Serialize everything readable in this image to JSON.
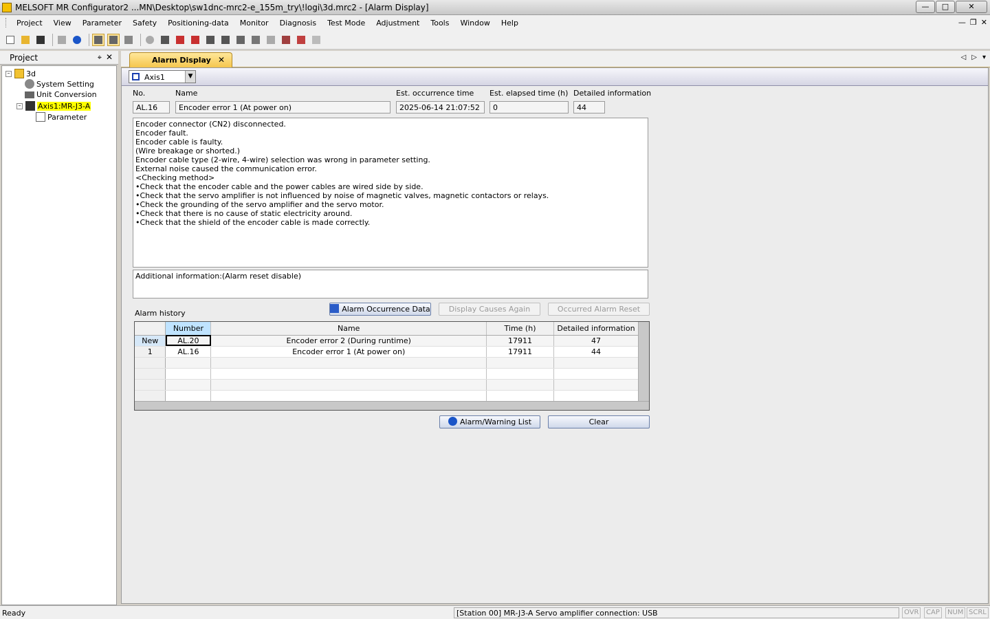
{
  "window": {
    "title": "MELSOFT MR Configurator2 ...MN\\Desktop\\sw1dnc-mrc2-e_155m_try\\!logi\\3d.mrc2 - [Alarm Display]"
  },
  "menu": [
    "Project",
    "View",
    "Parameter",
    "Safety",
    "Positioning-data",
    "Monitor",
    "Diagnosis",
    "Test Mode",
    "Adjustment",
    "Tools",
    "Window",
    "Help"
  ],
  "project_pane": {
    "title": "Project",
    "tree": {
      "root": "3d",
      "system_setting": "System Setting",
      "unit_conversion": "Unit Conversion",
      "axis": "Axis1:MR-J3-A",
      "parameter": "Parameter"
    }
  },
  "tab": {
    "label": "Alarm Display"
  },
  "axis_select": {
    "value": "Axis1"
  },
  "alarm": {
    "labels": {
      "no": "No.",
      "name": "Name",
      "occurrence": "Est. occurrence time",
      "elapsed": "Est. elapsed time (h)",
      "detail": "Detailed information"
    },
    "no": "AL.16",
    "name": "Encoder error 1 (At power on)",
    "occurrence": "2025-06-14 21:07:52",
    "elapsed": "0",
    "detail": "44",
    "description": [
      "Encoder connector (CN2) disconnected.",
      "",
      "Encoder fault.",
      "",
      "Encoder cable is faulty.",
      "(Wire breakage or shorted.)",
      "",
      "Encoder cable type (2-wire, 4-wire) selection was wrong in parameter setting.",
      "",
      "External noise caused the communication error.",
      "<Checking method>",
      "•Check that the encoder cable and the power cables are wired side by side.",
      "•Check that the servo amplifier is not influenced by noise of magnetic valves, magnetic contactors or relays.",
      "•Check the grounding of the servo amplifier and the servo motor.",
      "•Check that there is no cause of static electricity around.",
      "•Check that the shield of the encoder cable is made correctly."
    ],
    "additional": "Additional information:(Alarm reset disable)"
  },
  "history": {
    "title": "Alarm history",
    "buttons": {
      "occurrence_data": "Alarm Occurrence Data",
      "display_causes": "Display Causes Again",
      "occurred_reset": "Occurred Alarm Reset"
    },
    "columns": [
      "Number",
      "Name",
      "Time (h)",
      "Detailed information"
    ],
    "rows": [
      {
        "row": "New",
        "number": "AL.20",
        "name": "Encoder error 2 (During runtime)",
        "time": "17911",
        "detail": "47"
      },
      {
        "row": "1",
        "number": "AL.16",
        "name": "Encoder error 1 (At power on)",
        "time": "17911",
        "detail": "44"
      }
    ]
  },
  "bottom_buttons": {
    "list": "Alarm/Warning List",
    "clear": "Clear"
  },
  "status": {
    "left": "Ready",
    "connection": "[Station 00] MR-J3-A Servo amplifier connection: USB",
    "ovr": "OVR",
    "cap": "CAP",
    "num": "NUM",
    "scrl": "SCRL"
  }
}
